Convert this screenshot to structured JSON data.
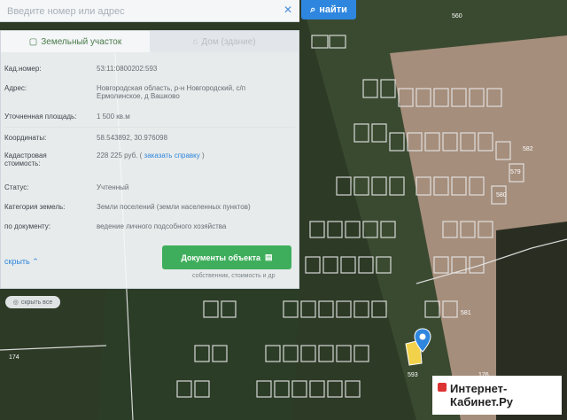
{
  "search": {
    "placeholder": "Введите номер или адрес",
    "button_label": "найти"
  },
  "tabs": [
    {
      "label": "Земельный участок",
      "active": true
    },
    {
      "label": "Дом (здание)",
      "active": false
    }
  ],
  "details": {
    "cad_number": {
      "label": "Кад.номер:",
      "value": "53:11:0800202:593"
    },
    "address": {
      "label": "Адрес:",
      "value_line1": "Новгородская область, р-н Новгородский, с/п",
      "value_line2": "Ермолинское, д Вашково"
    },
    "area": {
      "label": "Уточненная площадь:",
      "value": "1 500 кв.м"
    },
    "coords": {
      "label": "Координаты:",
      "value": "58.543892, 30.976098"
    },
    "cost": {
      "label_line1": "Кадастровая",
      "label_line2": "стоимость:",
      "value": "228 225 руб.",
      "link": "заказать справку",
      "close_paren": ")",
      "open_paren": "("
    },
    "status": {
      "label": "Статус:",
      "value": "Учтенный"
    },
    "category": {
      "label": "Категория земель:",
      "value": "Земли поселений (земли населенных пунктов)"
    },
    "usage": {
      "label": "по документу:",
      "value": "ведение личного подсобного хозяйства"
    }
  },
  "actions": {
    "hide_label": "скрыть",
    "docs_button": "Документы объекта",
    "docs_note": "собственник, стоимость и др",
    "hide_all": "скрыть все"
  },
  "map": {
    "labels": [
      "174",
      "176",
      "579",
      "580",
      "582",
      "560",
      "581",
      "593"
    ]
  },
  "brand": {
    "line1": "Интернет-",
    "line2": "Кабинет.Ру"
  },
  "colors": {
    "accent": "#2e86de",
    "button_green": "#3fae5c",
    "parcel_line": "#e8e8e8"
  }
}
